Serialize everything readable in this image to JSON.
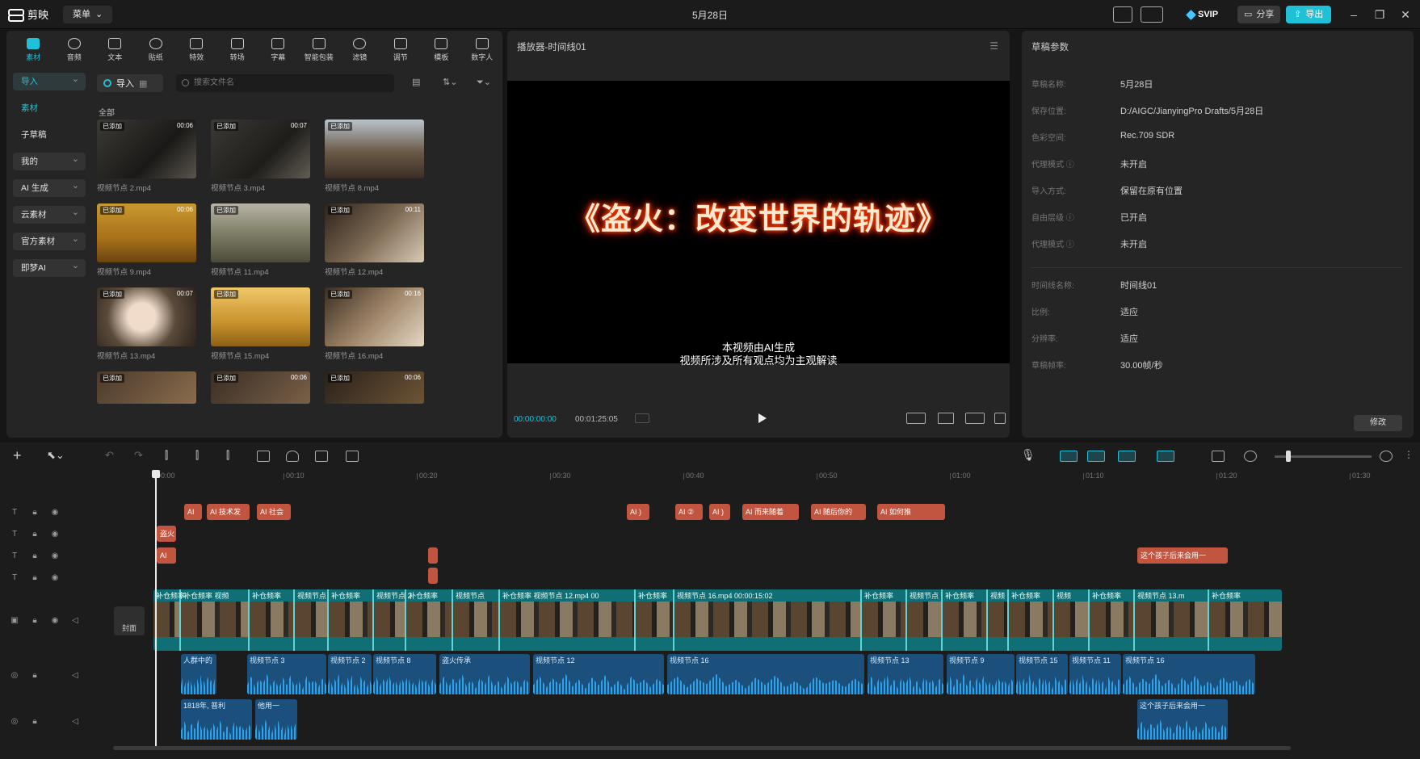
{
  "app": {
    "name": "剪映",
    "menu_label": "菜单",
    "title": "5月28日"
  },
  "header": {
    "svip_label": "SVIP",
    "share_label": "分享",
    "export_label": "导出"
  },
  "tool_tabs": [
    "素材",
    "音频",
    "文本",
    "贴纸",
    "特效",
    "转场",
    "字幕",
    "智能包装",
    "滤镜",
    "调节",
    "模板",
    "数字人"
  ],
  "side_nav": [
    "导入",
    "素材",
    "子草稿",
    "我的",
    "AI 生成",
    "云素材",
    "官方素材",
    "即梦AI"
  ],
  "media": {
    "import_label": "导入",
    "search_placeholder": "搜索文件名",
    "all_label": "全部",
    "clips": [
      {
        "name": "视频节点 2.mp4",
        "badge": "已添加",
        "duration": "00:06"
      },
      {
        "name": "视频节点 3.mp4",
        "badge": "已添加",
        "duration": "00:07"
      },
      {
        "name": "视频节点 8.mp4",
        "badge": "已添加",
        "duration": ""
      },
      {
        "name": "视频节点 9.mp4",
        "badge": "已添加",
        "duration": "00:06"
      },
      {
        "name": "视频节点 11.mp4",
        "badge": "已添加",
        "duration": ""
      },
      {
        "name": "视频节点 12.mp4",
        "badge": "已添加",
        "duration": "00:11"
      },
      {
        "name": "视频节点 13.mp4",
        "badge": "已添加",
        "duration": "00:07"
      },
      {
        "name": "视频节点 15.mp4",
        "badge": "已添加",
        "duration": ""
      },
      {
        "name": "视频节点 16.mp4",
        "badge": "已添加",
        "duration": "00:16"
      },
      {
        "name": "",
        "badge": "已添加",
        "duration": ""
      },
      {
        "name": "",
        "badge": "已添加",
        "duration": "00:06"
      },
      {
        "name": "",
        "badge": "已添加",
        "duration": "00:06"
      }
    ]
  },
  "player": {
    "title": "播放器-时间线01",
    "video_title": "《盗火：改变世界的轨迹》",
    "subtitle_line1": "本视频由AI生成",
    "subtitle_line2": "视频所涉及所有观点均为主观解读",
    "current_time": "00:00:00:00",
    "total_time": "00:01:25:05"
  },
  "properties": {
    "title": "草稿参数",
    "rows": [
      {
        "key": "草稿名称:",
        "value": "5月28日"
      },
      {
        "key": "保存位置:",
        "value": "D:/AIGC/JianyingPro Drafts/5月28日"
      },
      {
        "key": "色彩空间:",
        "value": "Rec.709 SDR"
      },
      {
        "key": "代理模式 ⓘ",
        "value": "未开启"
      },
      {
        "key": "导入方式:",
        "value": "保留在原有位置"
      },
      {
        "key": "自由层级 ⓘ",
        "value": "已开启"
      },
      {
        "key": "代理模式 ⓘ",
        "value": "未开启"
      },
      {
        "key": "时间线名称:",
        "value": "时间线01"
      },
      {
        "key": "比例:",
        "value": "适应"
      },
      {
        "key": "分辨率:",
        "value": "适应"
      },
      {
        "key": "草稿帧率:",
        "value": "30.00帧/秒"
      }
    ],
    "modify_label": "修改"
  },
  "timeline": {
    "ruler": [
      "00:00",
      "00:10",
      "00:20",
      "00:30",
      "00:40",
      "00:50",
      "01:00",
      "01:10",
      "01:20",
      "01:30"
    ],
    "cover_label": "封面",
    "text_row1": [
      "AI",
      "AI 技术发",
      "AI 社会",
      "AI )",
      "AI ②",
      "AI )",
      "AI 而来随着",
      "AI 随后你的",
      "AI 如何推"
    ],
    "text_row2": [
      "盗火"
    ],
    "text_row3": [
      "AI",
      "这个孩子后来会用一"
    ],
    "video_segments": [
      "补仓频率",
      "补仓频率 视频",
      "补仓频率",
      "视频节点",
      "补仓频率",
      "视频节点 2",
      "补仓频率",
      "视频节点",
      "补仓频率 视频节点 12.mp4 00",
      "补仓频率",
      "视频节点 16.mp4  00:00:15:02",
      "补仓频率",
      "视频节点",
      "补仓频率",
      "视频",
      "补仓频率",
      "视频",
      "补仓频率",
      "视频节点 13.m",
      "补仓频率"
    ],
    "audio1": [
      "人群中的",
      "视频节点 3",
      "视频节点 2",
      "视频节点 8",
      "盗火传承",
      "视频节点 12",
      "视频节点 16",
      "视频节点 13",
      "视频节点 9",
      "视频节点 15",
      "视频节点 11",
      "视频节点 16"
    ],
    "audio2": [
      "1818年, 普利",
      "他用一",
      "这个孩子后来会用一"
    ]
  }
}
